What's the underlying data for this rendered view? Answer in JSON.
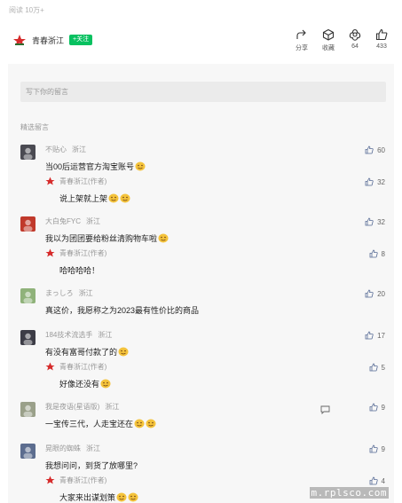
{
  "header": {
    "reads": "阅读 10万+",
    "account_name": "青春浙江",
    "follow_label": "+关注",
    "actions": [
      {
        "icon": "share-icon",
        "label": "分享"
      },
      {
        "icon": "collect-icon",
        "label": "收藏"
      },
      {
        "icon": "flower-icon",
        "label": "64"
      },
      {
        "icon": "thumbs-up-icon",
        "label": "433"
      }
    ]
  },
  "comment_input": {
    "placeholder": "写下你的留言"
  },
  "section_title": "精选留言",
  "comments": [
    {
      "name": "不贴心",
      "location": "浙江",
      "text": "当00后运营官方淘宝账号",
      "likes": "60",
      "emoji_count": 1,
      "reply": {
        "name": "青春浙江(作者)",
        "text": "说上架就上架",
        "likes": "32",
        "emoji_count": 2
      }
    },
    {
      "name": "大白兔FYC",
      "location": "浙江",
      "text": "我以为团团要给粉丝清购物车啦",
      "likes": "32",
      "emoji_count": 1,
      "reply": {
        "name": "青春浙江(作者)",
        "text": "哈哈哈哈！",
        "likes": "8",
        "emoji_count": 0
      }
    },
    {
      "name": "まっしろ",
      "location": "浙江",
      "text": "真这价，我愿称之为2023最有性价比的商品",
      "likes": "20",
      "emoji_count": 0
    },
    {
      "name": "184技术流选手",
      "location": "浙江",
      "text": "有没有富哥付款了的",
      "likes": "17",
      "emoji_count": 1,
      "reply": {
        "name": "青春浙江(作者)",
        "text": "好像还没有",
        "likes": "5",
        "emoji_count": 1
      }
    },
    {
      "name": "我是夜语(星语版)",
      "location": "浙江",
      "text": "一宝传三代，人走宝还在",
      "likes": "9",
      "emoji_count": 2
    },
    {
      "name": "晃眼的蜘蛛",
      "location": "浙江",
      "text": "我想问问，到货了放哪里?",
      "likes": "9",
      "emoji_count": 0,
      "reply": {
        "name": "青春浙江(作者)",
        "text": "大家来出谋划策",
        "likes": "4",
        "emoji_count": 2
      }
    }
  ],
  "watermark": "m.rplsco.com",
  "colors": {
    "accent": "#07c160",
    "background": "#f7f7f7"
  }
}
